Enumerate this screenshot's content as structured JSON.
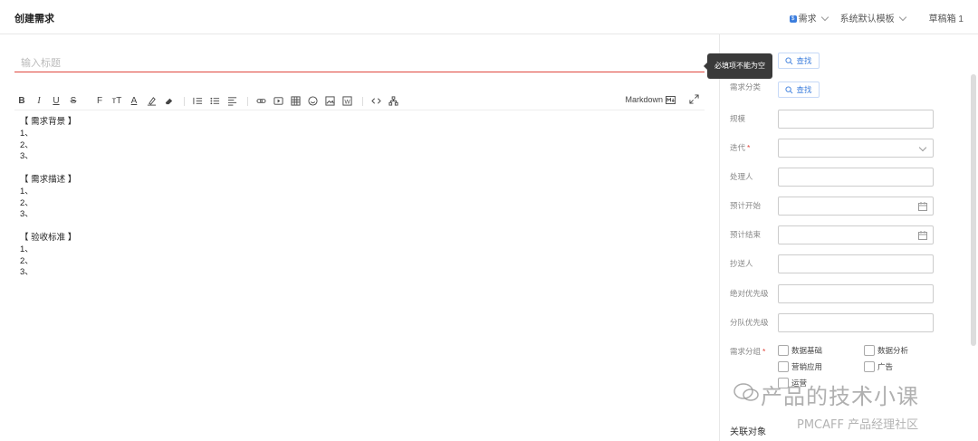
{
  "header": {
    "title": "创建需求",
    "type_badge": "需求",
    "type_label": "需求",
    "template_label": "系统默认模板",
    "drafts_label": "草稿箱 1"
  },
  "editor": {
    "title_placeholder": "输入标题",
    "markdown_label": "Markdown",
    "content": [
      "【 需求背景 】",
      "1、",
      "2、",
      "3、",
      "",
      "【 需求描述 】",
      "1、",
      "2、",
      "3、",
      "",
      "【 验收标准 】",
      "1、",
      "2、",
      "3、"
    ],
    "toolbar": {
      "bold": "B",
      "italic": "I",
      "underline": "U",
      "strike": "S",
      "font": "F",
      "size": "тT",
      "color": "A"
    }
  },
  "tooltip": "必填项不能为空",
  "panel": {
    "find_label": "查找",
    "category_label": "需求分类",
    "scale_label": "规模",
    "iteration_label": "迭代",
    "handler_label": "处理人",
    "start_label": "预计开始",
    "end_label": "预计结束",
    "cc_label": "抄送人",
    "abs_priority_label": "绝对优先级",
    "team_priority_label": "分队优先级",
    "group_label": "需求分组",
    "groups": [
      "数据基础",
      "数据分析",
      "营销应用",
      "广告",
      "运营"
    ],
    "assoc_label": "关联对象"
  },
  "watermark": {
    "main": "产品的技术小课",
    "sub": "PMCAFF 产品经理社区"
  },
  "colors": {
    "accent": "#3b7ddd",
    "error": "#e0463d"
  }
}
